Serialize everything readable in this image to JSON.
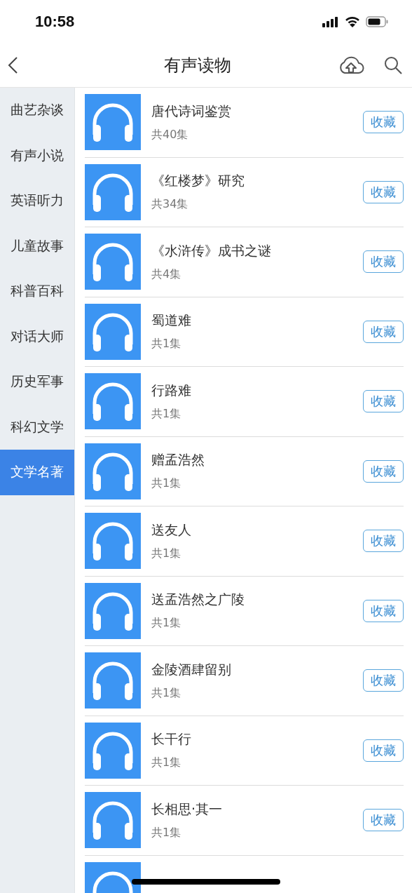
{
  "status_bar": {
    "time": "10:58"
  },
  "header": {
    "title": "有声读物"
  },
  "sidebar": {
    "items": [
      {
        "label": "曲艺杂谈",
        "selected": false
      },
      {
        "label": "有声小说",
        "selected": false
      },
      {
        "label": "英语听力",
        "selected": false
      },
      {
        "label": "儿童故事",
        "selected": false
      },
      {
        "label": "科普百科",
        "selected": false
      },
      {
        "label": "对话大师",
        "selected": false
      },
      {
        "label": "历史军事",
        "selected": false
      },
      {
        "label": "科幻文学",
        "selected": false
      },
      {
        "label": "文学名著",
        "selected": true
      }
    ]
  },
  "books": [
    {
      "title": "唐代诗词鉴赏",
      "count": "共40集",
      "action": "收藏"
    },
    {
      "title": "《红楼梦》研究",
      "count": "共34集",
      "action": "收藏"
    },
    {
      "title": "《水浒传》成书之谜",
      "count": "共4集",
      "action": "收藏"
    },
    {
      "title": "蜀道难",
      "count": "共1集",
      "action": "收藏"
    },
    {
      "title": "行路难",
      "count": "共1集",
      "action": "收藏"
    },
    {
      "title": "赠孟浩然",
      "count": "共1集",
      "action": "收藏"
    },
    {
      "title": "送友人",
      "count": "共1集",
      "action": "收藏"
    },
    {
      "title": "送孟浩然之广陵",
      "count": "共1集",
      "action": "收藏"
    },
    {
      "title": "金陵酒肆留别",
      "count": "共1集",
      "action": "收藏"
    },
    {
      "title": "长干行",
      "count": "共1集",
      "action": "收藏"
    },
    {
      "title": "长相思·其一",
      "count": "共1集",
      "action": "收藏"
    }
  ]
}
